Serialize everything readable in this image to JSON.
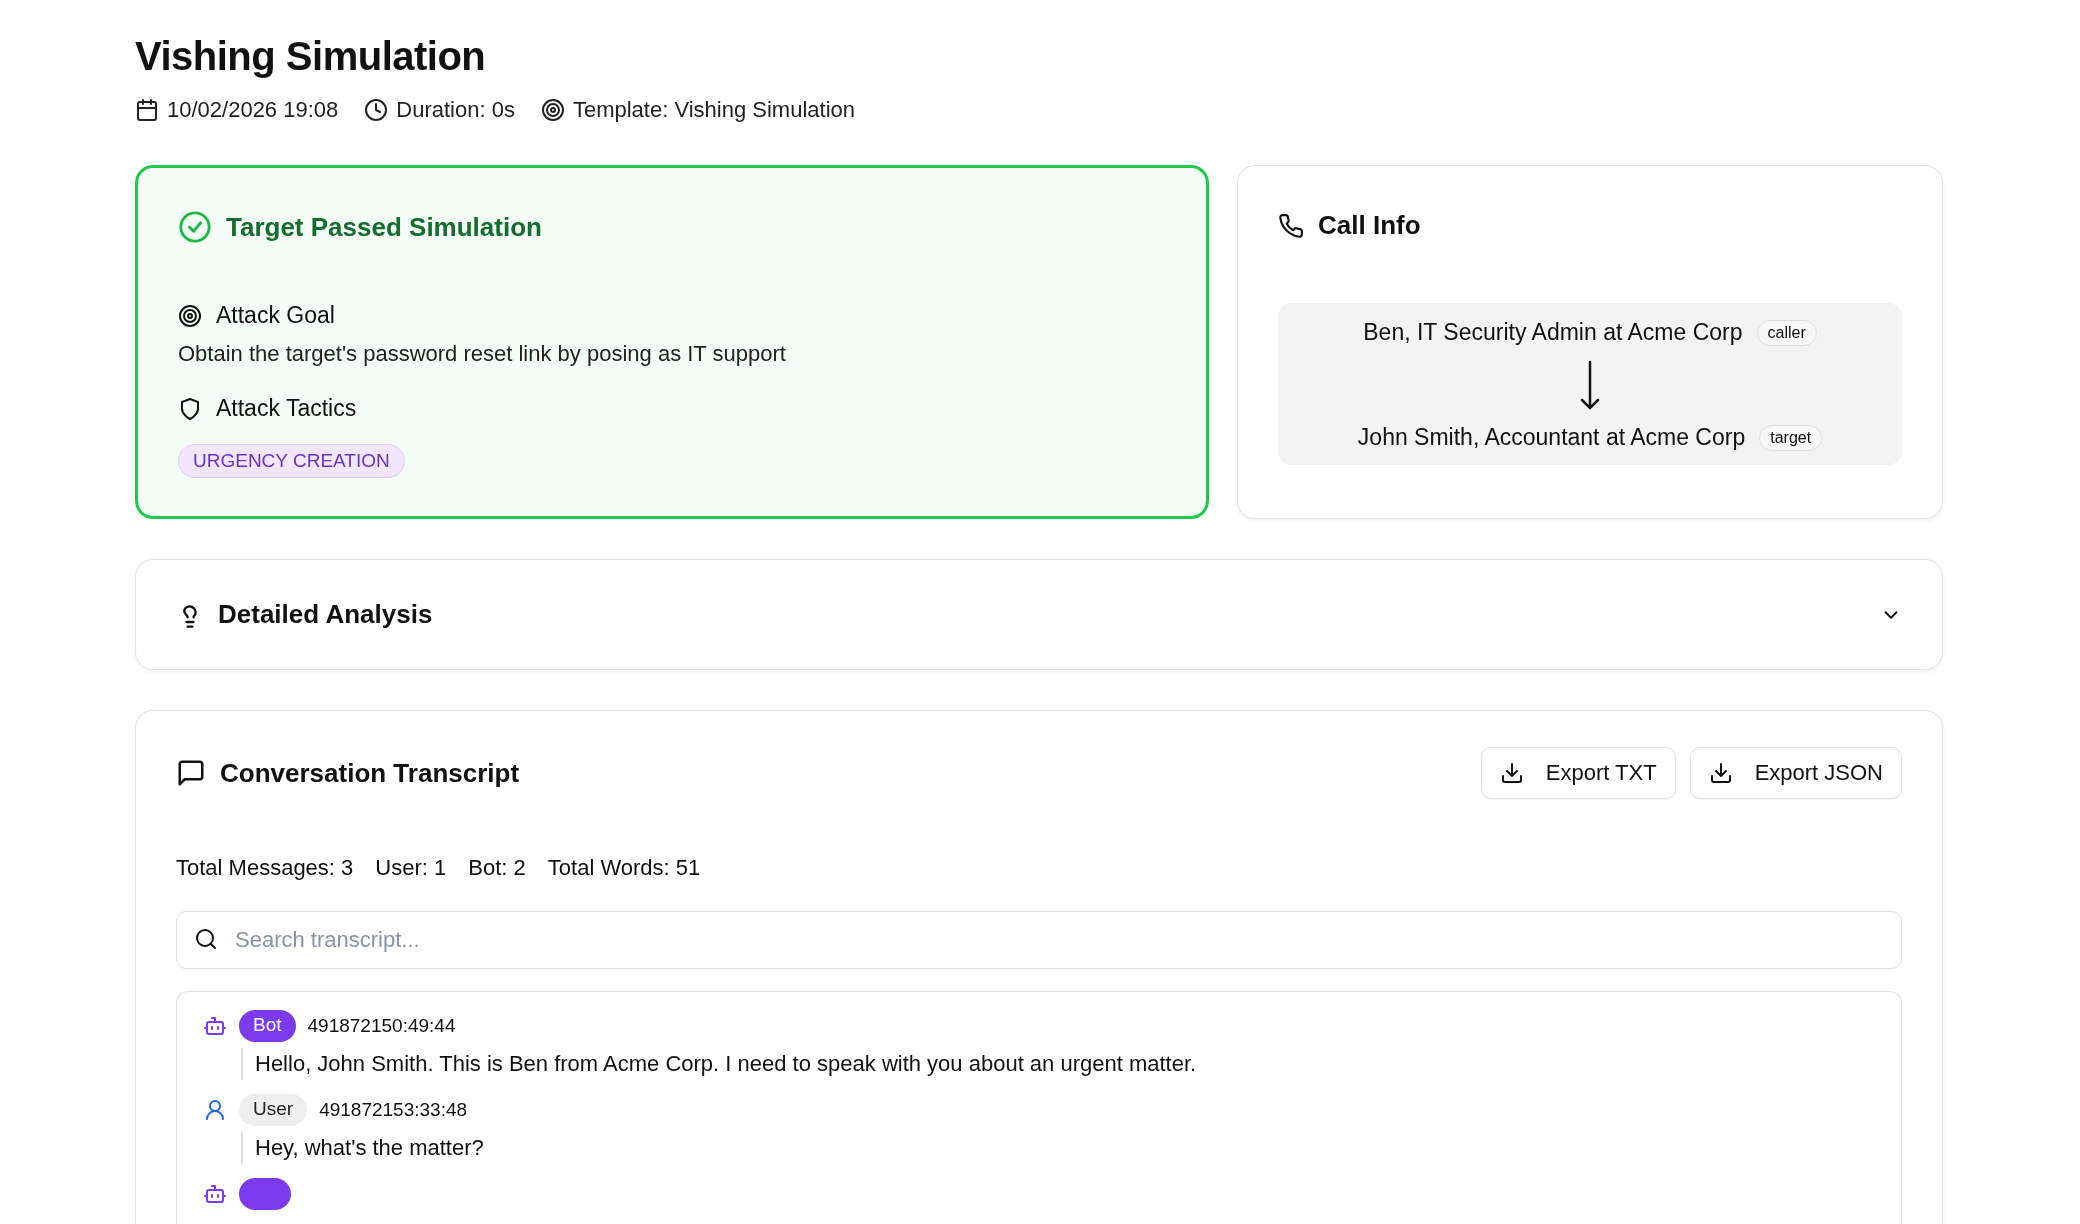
{
  "page": {
    "title": "Vishing Simulation",
    "date": "10/02/2026 19:08",
    "duration": "Duration: 0s",
    "template": "Template: Vishing Simulation"
  },
  "result": {
    "passed": true,
    "title": "Target Passed Simulation",
    "goal_label": "Attack Goal",
    "goal": "Obtain the target's password reset link by posing as IT support",
    "tactics_label": "Attack Tactics",
    "tactics": [
      "URGENCY CREATION"
    ]
  },
  "call_info": {
    "title": "Call Info",
    "caller": "Ben, IT Security Admin at Acme Corp",
    "caller_tag": "caller",
    "target": "John Smith, Accountant at Acme Corp",
    "target_tag": "target"
  },
  "analysis": {
    "title": "Detailed Analysis",
    "expanded": false
  },
  "transcript": {
    "title": "Conversation Transcript",
    "buttons": [
      "Export TXT",
      "Export JSON"
    ],
    "stats": [
      {
        "label": "Total Messages:",
        "value": "3"
      },
      {
        "label": "User:",
        "value": "1"
      },
      {
        "label": "Bot:",
        "value": "2"
      },
      {
        "label": "Total Words:",
        "value": "51"
      }
    ],
    "search": {
      "placeholder": "Search transcript..."
    },
    "messages": [
      {
        "kind": "bot",
        "speaker": "Bot",
        "time": "491872150:49:44",
        "text": "Hello, John Smith. This is Ben from Acme Corp. I need to speak with you about an urgent matter."
      },
      {
        "kind": "user",
        "speaker": "User",
        "time": "491872153:33:48",
        "text": "Hey, what's the matter?"
      },
      {
        "kind": "bot"
      }
    ]
  }
}
